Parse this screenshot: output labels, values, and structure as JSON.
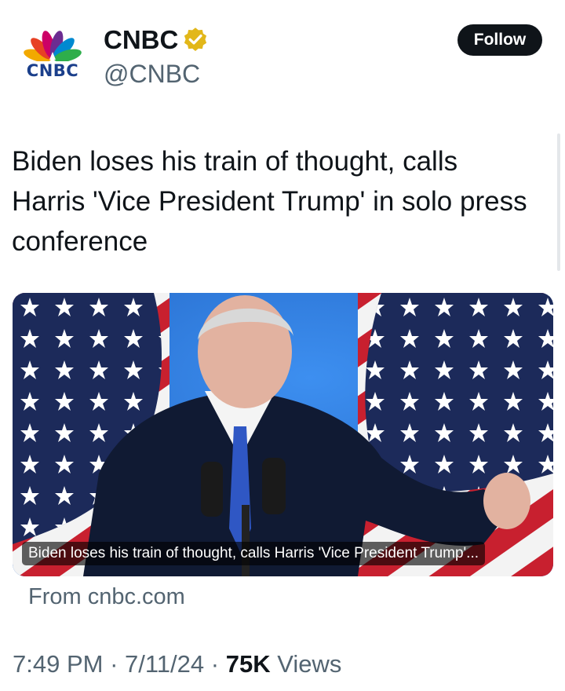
{
  "account": {
    "logo_text": "CNBC",
    "display_name": "CNBC",
    "handle": "@CNBC",
    "verified": true,
    "follow_label": "Follow"
  },
  "tweet": {
    "text": "Biden loses his train of thought, calls Harris 'Vice President Trump' in solo press conference"
  },
  "link_card": {
    "image_icon": "photo-biden-podium-flags",
    "caption": "Biden loses his train of thought, calls Harris 'Vice President Trump'...",
    "source": "From cnbc.com"
  },
  "meta": {
    "time": "7:49 PM",
    "sep1": " · ",
    "date": "7/11/24",
    "sep2": " · ",
    "views_count": "75K",
    "views_label": " Views"
  },
  "colors": {
    "text": "#0f1419",
    "secondary": "#536471",
    "follow_bg": "#0f1419",
    "verified_gold": "#e2b719",
    "backdrop_blue": "#2a73d6"
  }
}
